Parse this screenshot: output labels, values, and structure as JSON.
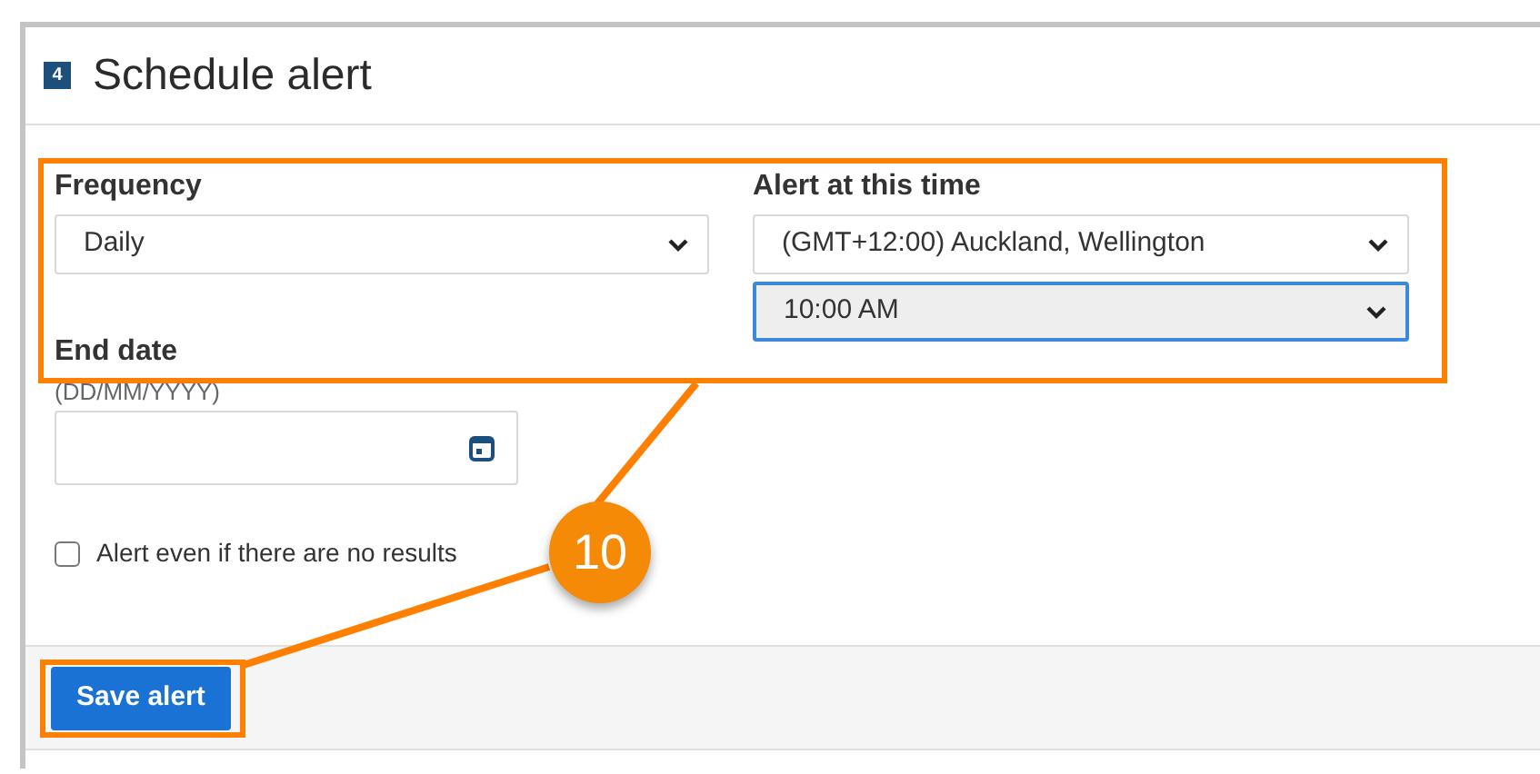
{
  "section": {
    "step": "4",
    "title": "Schedule alert"
  },
  "frequency": {
    "label": "Frequency",
    "value": "Daily"
  },
  "alert_time": {
    "label": "Alert at this time",
    "timezone": "(GMT+12:00) Auckland, Wellington",
    "time": "10:00 AM",
    "time_focused": true
  },
  "end_date": {
    "label": "End date",
    "hint": "(DD/MM/YYYY)"
  },
  "no_results_alert": {
    "label": "Alert even if there are no results",
    "checked": false
  },
  "save_button": "Save alert",
  "callout": {
    "number": "10"
  }
}
